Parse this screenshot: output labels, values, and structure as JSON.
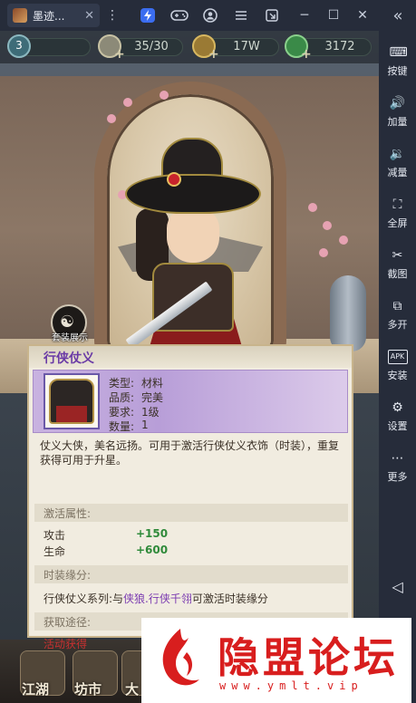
{
  "titlebar": {
    "tab_title": "墨迹...",
    "tab_close": "✕",
    "buttons": {
      "menu": "⋮",
      "minimize": "─",
      "maximize": "☐",
      "close": "✕",
      "collapse": "«"
    }
  },
  "sidebar": {
    "items": [
      {
        "label": "按键",
        "icon": "keyboard-icon",
        "glyph": "⌨"
      },
      {
        "label": "加量",
        "icon": "volume-up-icon",
        "glyph": "🔊"
      },
      {
        "label": "减量",
        "icon": "volume-down-icon",
        "glyph": "🔉"
      },
      {
        "label": "全屏",
        "icon": "fullscreen-icon",
        "glyph": "⛶"
      },
      {
        "label": "截图",
        "icon": "scissors-icon",
        "glyph": "✂"
      },
      {
        "label": "多开",
        "icon": "multi-instance-icon",
        "glyph": "⧉"
      },
      {
        "label": "安装",
        "icon": "apk-install-icon",
        "glyph": "APK"
      },
      {
        "label": "设置",
        "icon": "settings-icon",
        "glyph": "⚙"
      },
      {
        "label": "更多",
        "icon": "more-icon",
        "glyph": "⋯"
      }
    ],
    "back_glyph": "◁"
  },
  "resources": {
    "level": "3",
    "stamina": "35/30",
    "coins": "17W",
    "jade": "3172",
    "plus": "+"
  },
  "scene": {
    "suit_show_label": "套装展示",
    "suit_show_icon": "☯"
  },
  "item": {
    "name": "行侠仗义",
    "type_label": "类型:",
    "type_value": "材料",
    "quality_label": "品质:",
    "quality_value": "完美",
    "require_label": "要求:",
    "require_value": "1级",
    "count_label": "数量:",
    "count_value": "1",
    "description": "仗义大侠，美名远扬。可用于激活行侠仗义衣饰（时装），重复获得可用于升星。",
    "attr_section": "激活属性:",
    "stats": [
      {
        "name": "攻击",
        "value": "+150"
      },
      {
        "name": "生命",
        "value": "+600"
      }
    ],
    "fate_section": "时装缘分:",
    "fate_prefix": "行侠仗义系列:与",
    "fate_names": "侠狼.行侠千翎",
    "fate_suffix": "可激活时装缘分",
    "source_section": "获取途径:",
    "source_value": "活动获得"
  },
  "bottom_nav": {
    "items": [
      "江湖",
      "坊市",
      "大"
    ]
  },
  "watermark": {
    "title": "隐盟论坛",
    "url": "www.ymlt.vip"
  },
  "colors": {
    "purple_title": "#6a3aa6",
    "stat_green": "#2f8a3a",
    "source_red": "#c83030",
    "watermark_red": "#d81e1e"
  }
}
